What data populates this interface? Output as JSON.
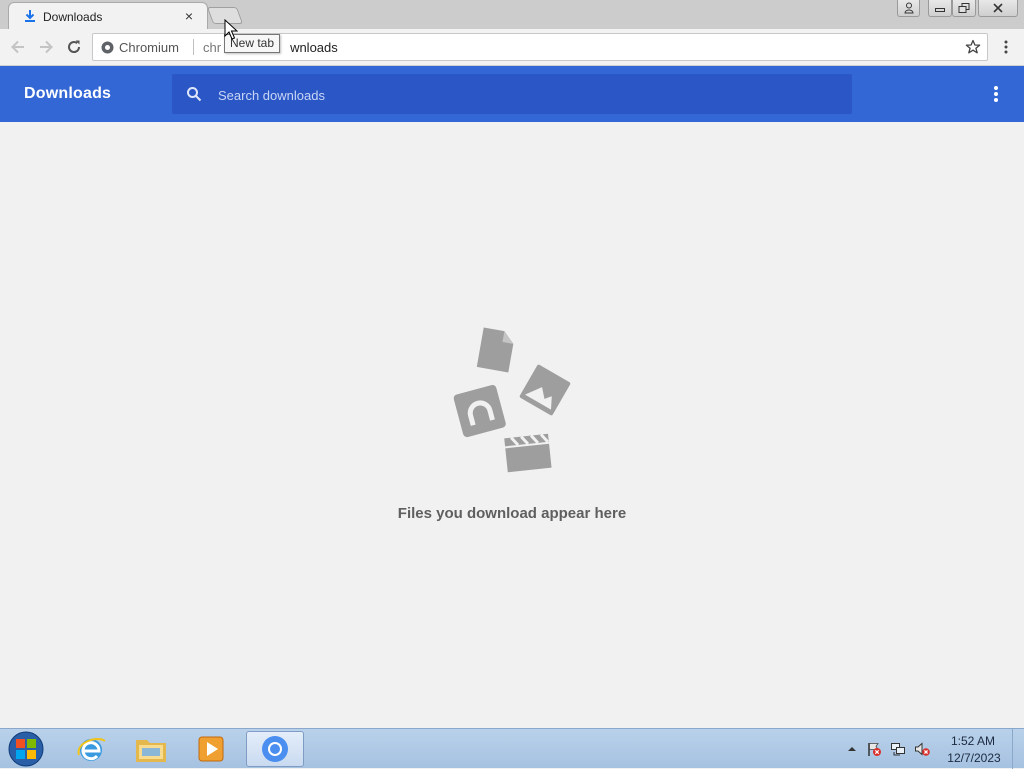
{
  "browser": {
    "tab": {
      "title": "Downloads",
      "close_symbol": "×"
    },
    "new_tab_tooltip": "New tab",
    "omnibox": {
      "site_name": "Chromium",
      "url_hidden_part": "chr",
      "url_visible_part": "wnloads"
    }
  },
  "downloads_page": {
    "title": "Downloads",
    "search_placeholder": "Search downloads",
    "empty_message": "Files you download appear here"
  },
  "taskbar": {
    "clock_time": "1:52 AM",
    "clock_date": "12/7/2023"
  },
  "colors": {
    "header_blue": "#3367d6",
    "search_blue": "#2a56c6",
    "page_background": "#f1f1f1",
    "illustration_gray": "#9e9e9e"
  }
}
